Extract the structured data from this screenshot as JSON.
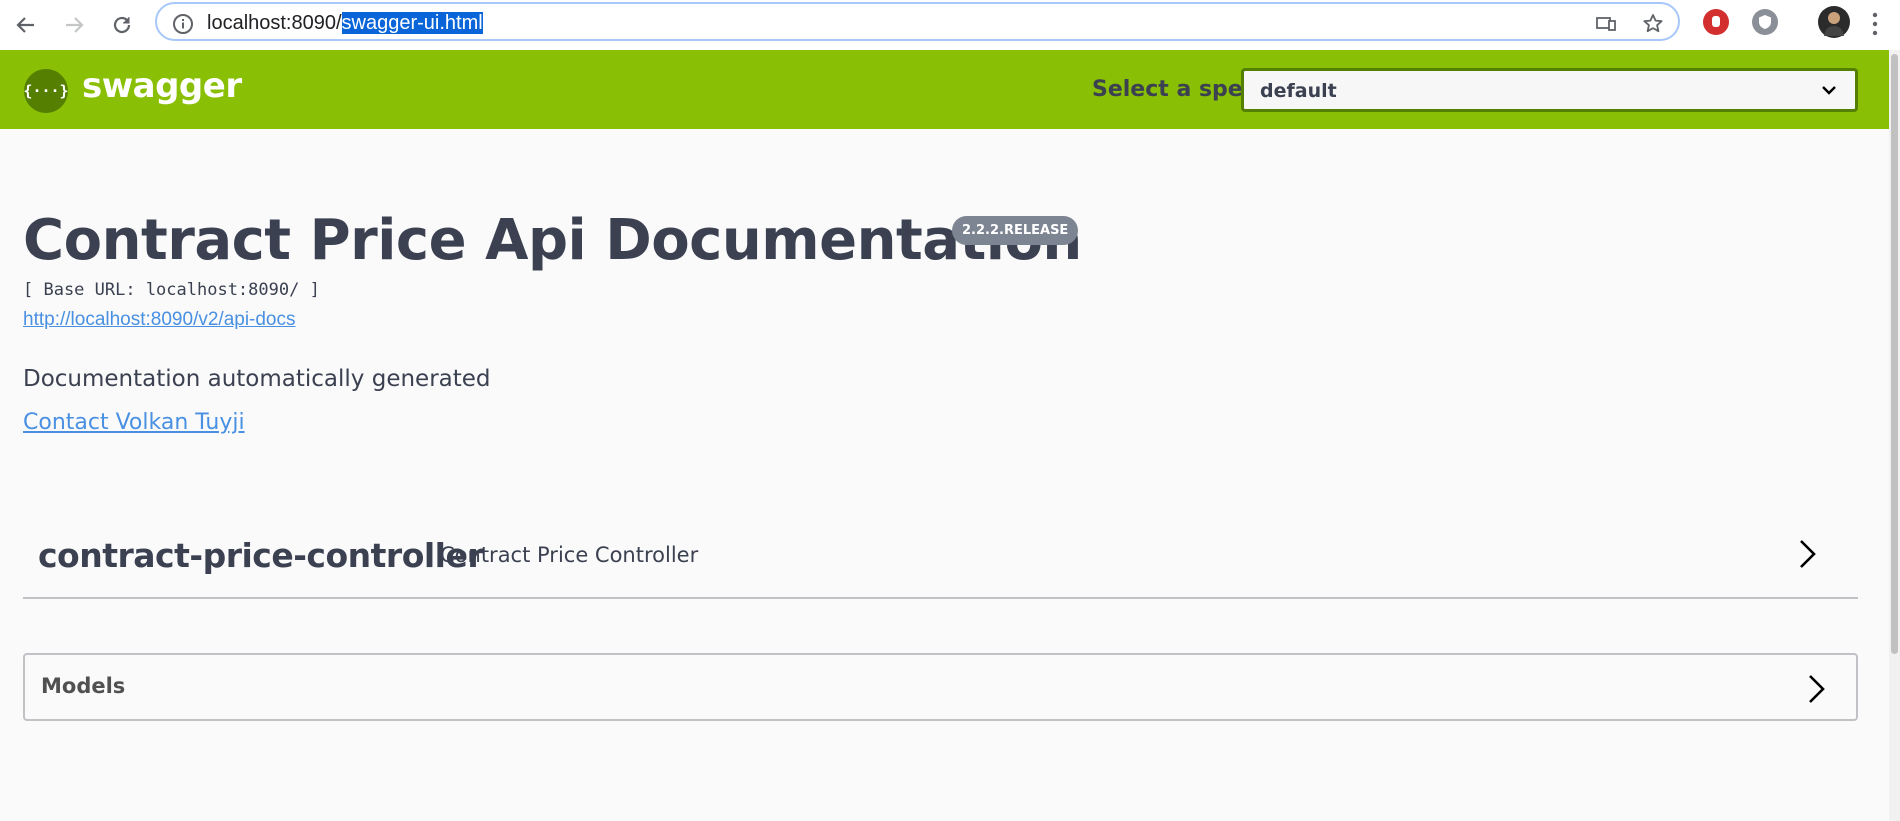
{
  "browser": {
    "url_host": "localhost:8090/",
    "url_path": "swagger-ui.html"
  },
  "topbar": {
    "logo_glyph": "{···}",
    "logo_text": "swagger",
    "spec_label": "Select a spec",
    "spec_value": "default",
    "color": "#89bf04"
  },
  "info": {
    "title": "Contract Price Api Documentation",
    "version": "2.2.2.RELEASE",
    "base_url": "[ Base URL: localhost:8090/ ]",
    "api_docs_link": "http://localhost:8090/v2/api-docs",
    "description": "Documentation automatically generated",
    "contact": "Contact Volkan Tuyji"
  },
  "tags": [
    {
      "name": "contract-price-controller",
      "description": "Contract Price Controller"
    }
  ],
  "models": {
    "title": "Models"
  },
  "colors": {
    "link": "#4990e2",
    "text": "#3b4151",
    "selection": "#0a66d8"
  }
}
